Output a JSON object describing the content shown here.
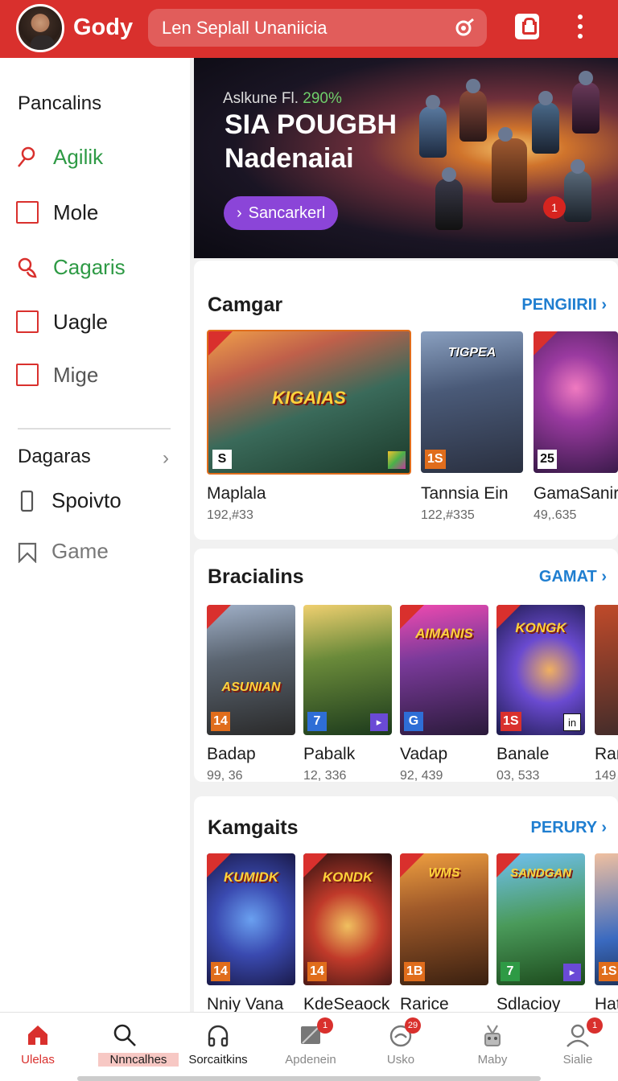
{
  "app": {
    "name": "Gody"
  },
  "search": {
    "placeholder": "Len Seplall Unaniicia"
  },
  "sidebar": {
    "heading": "Pancalins",
    "items": [
      {
        "label": "Agilik",
        "icon": "user-icon"
      },
      {
        "label": "Mole",
        "icon": "square-icon"
      },
      {
        "label": "Cagaris",
        "icon": "joystick-icon"
      },
      {
        "label": "Uagle",
        "icon": "square-icon"
      },
      {
        "label": "Mige",
        "icon": "square-icon"
      }
    ],
    "section": "Dagaras",
    "sub_items": [
      {
        "label": "Spoivto",
        "icon": "phone-icon"
      },
      {
        "label": "Game",
        "icon": "bookmark-icon"
      }
    ]
  },
  "hero": {
    "subtitle_prefix": "Aslkune Fl.",
    "subtitle_accent": "290%",
    "title_line1": "SIA POUGBH",
    "title_line2": "Nadenaiai",
    "button": "Sancarkerl",
    "badge": "1"
  },
  "sections": [
    {
      "title": "Camgar",
      "link": "PENGIIRII",
      "cards": [
        {
          "name": "Maplala",
          "count": "192,#33",
          "num": "S",
          "logo": "KIGAIAS"
        },
        {
          "name": "Tannsia Ein",
          "count": "122,#335",
          "num": "1S",
          "logo": "TIGPEA"
        },
        {
          "name": "GamaSanir",
          "count": "49,.635",
          "num": "25",
          "logo": ""
        }
      ]
    },
    {
      "title": "Bracialins",
      "link": "GAMAT",
      "cards": [
        {
          "name": "Badap",
          "count": "99, 36",
          "num": "14",
          "logo": "ASUNIAN"
        },
        {
          "name": "Pabalk",
          "count": "12, 336",
          "num": "7",
          "logo": ""
        },
        {
          "name": "Vadap",
          "count": "92, 439",
          "num": "G",
          "logo": "AIMANIS"
        },
        {
          "name": "Banale",
          "count": "03, 533",
          "num": "1S",
          "logo": "KONGK"
        },
        {
          "name": "Ran",
          "count": "149",
          "num": "",
          "logo": ""
        }
      ]
    },
    {
      "title": "Kamgaits",
      "link": "PERURY",
      "cards": [
        {
          "name": "Nniy Vana",
          "count": "",
          "num": "14",
          "logo": "KUMIDK"
        },
        {
          "name": "KdeSeaock",
          "count": "",
          "num": "14",
          "logo": "KONDK"
        },
        {
          "name": "Rarice",
          "count": "",
          "num": "1B",
          "logo": "WMS"
        },
        {
          "name": "Sdlacioy",
          "count": "",
          "num": "7",
          "logo": "SANDGAN"
        },
        {
          "name": "Hat",
          "count": "",
          "num": "1S",
          "logo": ""
        }
      ]
    }
  ],
  "bottom_nav": [
    {
      "label": "Ulelas",
      "icon": "home-icon"
    },
    {
      "label": "Nnncalhes",
      "icon": "search-icon"
    },
    {
      "label": "Sorcaitkins",
      "icon": "headphones-icon"
    },
    {
      "label": "Apdenein",
      "icon": "image-icon",
      "badge": "1"
    },
    {
      "label": "Usko",
      "icon": "gamepad-icon",
      "badge": "29"
    },
    {
      "label": "Maby",
      "icon": "robot-icon"
    },
    {
      "label": "Sialie",
      "icon": "profile-icon",
      "badge": "1"
    }
  ],
  "colors": {
    "brand": "#d9302d",
    "link": "#1f7ed0",
    "accent_green": "#2e9a45",
    "hero_button": "#8b45d8"
  }
}
